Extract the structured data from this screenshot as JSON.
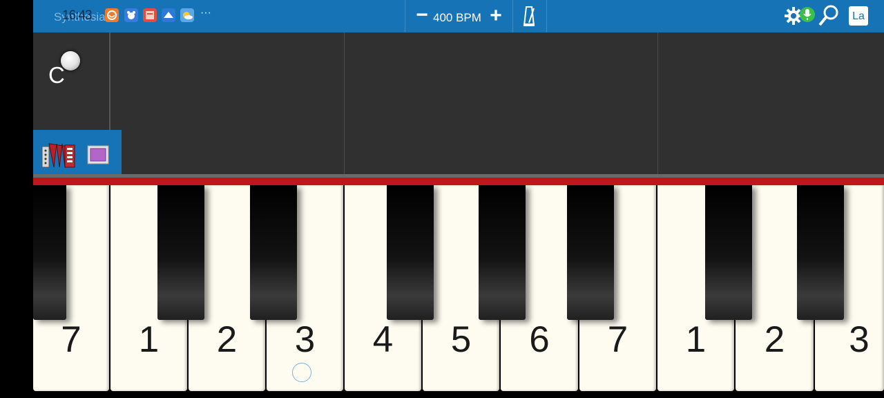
{
  "status": {
    "time": "16:43"
  },
  "header": {
    "app_title": "Synthesia"
  },
  "bpm": {
    "value_label": "400 BPM",
    "minus": "−",
    "plus": "+"
  },
  "track": {
    "key_letter": "C"
  },
  "toolbar": {
    "la_label": "La"
  },
  "keyboard": {
    "white_keys": [
      "7",
      "1",
      "2",
      "3",
      "4",
      "5",
      "6",
      "7",
      "1",
      "2",
      "3"
    ]
  },
  "colors": {
    "topbar": "#1573b6",
    "track_bg": "#303030",
    "key_rail": "#c0151a"
  },
  "icons": [
    "notification-app-1-icon",
    "notification-app-2-icon",
    "notification-app-3-icon",
    "notification-app-4-icon",
    "notification-app-5-icon",
    "more-icon",
    "metronome-icon",
    "settings-icon",
    "microphone-icon",
    "search-icon",
    "accordion-icon",
    "color-swatch-icon"
  ]
}
